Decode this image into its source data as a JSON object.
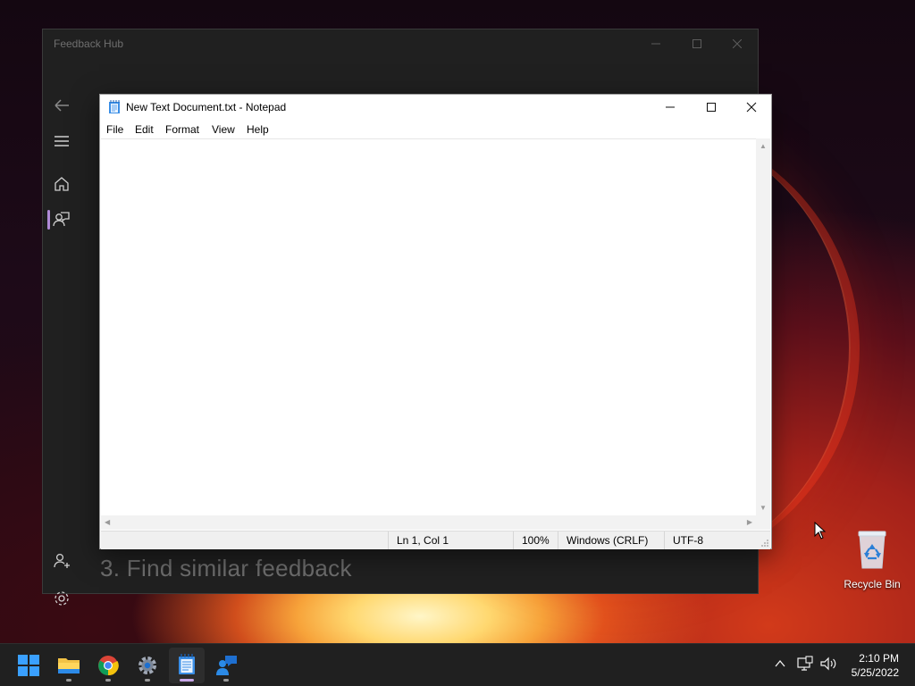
{
  "feedback_hub": {
    "title": "Feedback Hub",
    "bottom_text": "3. Find similar feedback"
  },
  "notepad": {
    "title": "New Text Document.txt - Notepad",
    "menu": [
      "File",
      "Edit",
      "Format",
      "View",
      "Help"
    ],
    "content": "",
    "status": {
      "position": "Ln 1, Col 1",
      "zoom": "100%",
      "line_ending": "Windows (CRLF)",
      "encoding": "UTF-8"
    }
  },
  "desktop": {
    "recycle_bin_label": "Recycle Bin"
  },
  "taskbar": {
    "apps": [
      "start-icon",
      "file-explorer-icon",
      "chrome-icon",
      "settings-icon",
      "notepad-icon",
      "feedback-hub-icon"
    ],
    "active_app": "notepad-icon",
    "time": "2:10 PM",
    "date": "5/25/2022"
  },
  "colors": {
    "accent": "#c9a7e8",
    "feedback_hub_bg": "#202020",
    "taskbar_bg": "#202020"
  }
}
